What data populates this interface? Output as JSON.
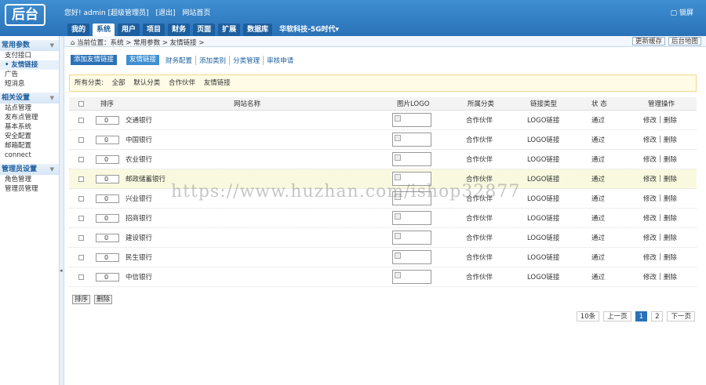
{
  "header": {
    "logo": "后台",
    "greeting": [
      "您好! admin [超级管理员]",
      "[退出]",
      "网站首页"
    ],
    "lock": "锁屏",
    "nav": [
      "我的",
      "系统",
      "用户",
      "项目",
      "财务",
      "页面",
      "扩展",
      "数据库",
      "华软科技-5G时代▾"
    ],
    "active_nav": "系统"
  },
  "sidebar": {
    "groups": [
      {
        "title": "常用参数",
        "items": [
          "支付接口",
          "友情链接",
          "广告",
          "短消息"
        ]
      },
      {
        "title": "相关设置",
        "items": [
          "站点管理",
          "发布点管理",
          "基本系统",
          "安全配置",
          "邮箱配置",
          "connect"
        ]
      },
      {
        "title": "管理员设置",
        "items": [
          "角色管理",
          "管理员管理"
        ]
      }
    ],
    "active_item": "友情链接"
  },
  "breadcrumb": "当前位置：系统 > 常用参数 > 友情链接 >",
  "crumb_actions": [
    "更新缓存",
    "后台地图"
  ],
  "tabs": {
    "add_button": "添加友情链接",
    "links": [
      "友情链接",
      "财务配置",
      "添加类别",
      "分类管理",
      "审核申请"
    ]
  },
  "filter": [
    "所有分类:",
    "全部",
    "默认分类",
    "合作伙伴",
    "友情链接"
  ],
  "table": {
    "headers": [
      "排序",
      "网站名称",
      "图片LOGO",
      "所属分类",
      "链接类型",
      "状 态",
      "管理操作"
    ],
    "rows": [
      {
        "sort": "0",
        "name": "交通银行",
        "category": "合作伙伴",
        "type": "LOGO链接",
        "status": "通过",
        "edit": "修改",
        "delete": "删除"
      },
      {
        "sort": "0",
        "name": "中国银行",
        "category": "合作伙伴",
        "type": "LOGO链接",
        "status": "通过",
        "edit": "修改",
        "delete": "删除"
      },
      {
        "sort": "0",
        "name": "农业银行",
        "category": "合作伙伴",
        "type": "LOGO链接",
        "status": "通过",
        "edit": "修改",
        "delete": "删除"
      },
      {
        "sort": "0",
        "name": "邮政储蓄银行",
        "category": "合作伙伴",
        "type": "LOGO链接",
        "status": "通过",
        "edit": "修改",
        "delete": "删除"
      },
      {
        "sort": "0",
        "name": "兴业银行",
        "category": "合作伙伴",
        "type": "LOGO链接",
        "status": "通过",
        "edit": "修改",
        "delete": "删除"
      },
      {
        "sort": "0",
        "name": "招商银行",
        "category": "合作伙伴",
        "type": "LOGO链接",
        "status": "通过",
        "edit": "修改",
        "delete": "删除"
      },
      {
        "sort": "0",
        "name": "建设银行",
        "category": "合作伙伴",
        "type": "LOGO链接",
        "status": "通过",
        "edit": "修改",
        "delete": "删除"
      },
      {
        "sort": "0",
        "name": "民生银行",
        "category": "合作伙伴",
        "type": "LOGO链接",
        "status": "通过",
        "edit": "修改",
        "delete": "删除"
      },
      {
        "sort": "0",
        "name": "中信银行",
        "category": "合作伙伴",
        "type": "LOGO链接",
        "status": "通过",
        "edit": "修改",
        "delete": "删除"
      }
    ],
    "highlight_row": 3
  },
  "bottom_buttons": [
    "排序",
    "删除"
  ],
  "pager": {
    "total": "10条",
    "prev": "上一页",
    "pages": [
      "1",
      "2"
    ],
    "current": "1",
    "next": "下一页"
  },
  "watermark": "https://www.huzhan.com/ishop32877"
}
